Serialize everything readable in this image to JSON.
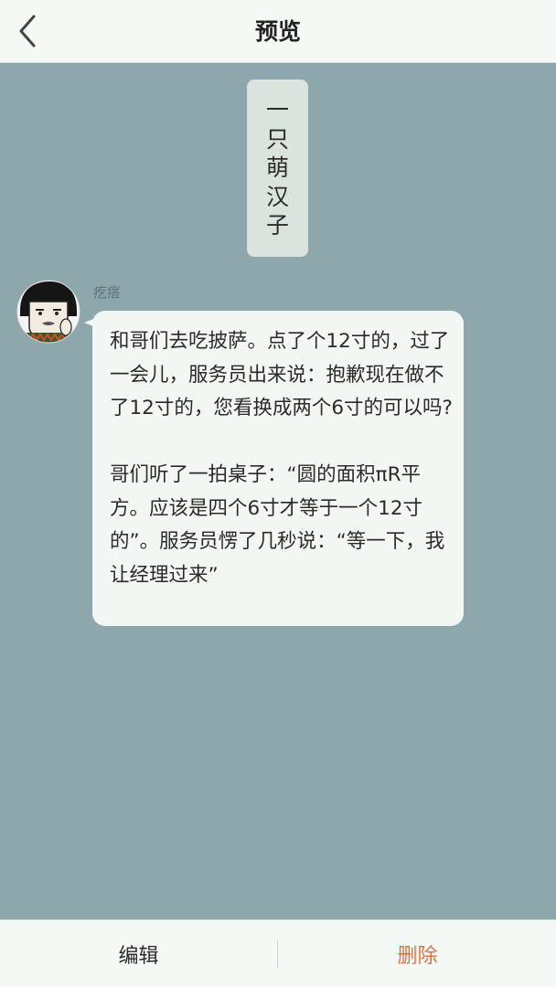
{
  "header": {
    "back_icon": "chevron-left-icon",
    "title": "预览"
  },
  "title_card": {
    "chars": [
      "一",
      "只",
      "萌",
      "汉",
      "子"
    ]
  },
  "message": {
    "sender": "疙瘩",
    "avatar_icon": "meme-face-avatar",
    "paragraphs": [
      "和哥们去吃披萨。点了个12寸的，过了一会儿，服务员出来说：抱歉现在做不了12寸的，您看换成两个6寸的可以吗?",
      "哥们听了一拍桌子：“圆的面积πR平方。应该是四个6寸才等于一个12寸的”。服务员愣了几秒说：“等一下，我让经理过来”"
    ]
  },
  "footer": {
    "edit_label": "编辑",
    "delete_label": "删除"
  },
  "colors": {
    "background": "#8ea7ad",
    "bar": "#f5f9f6",
    "bubble": "#f2f7f3",
    "title_card": "#dbe3df",
    "delete_accent": "#e2703e"
  }
}
